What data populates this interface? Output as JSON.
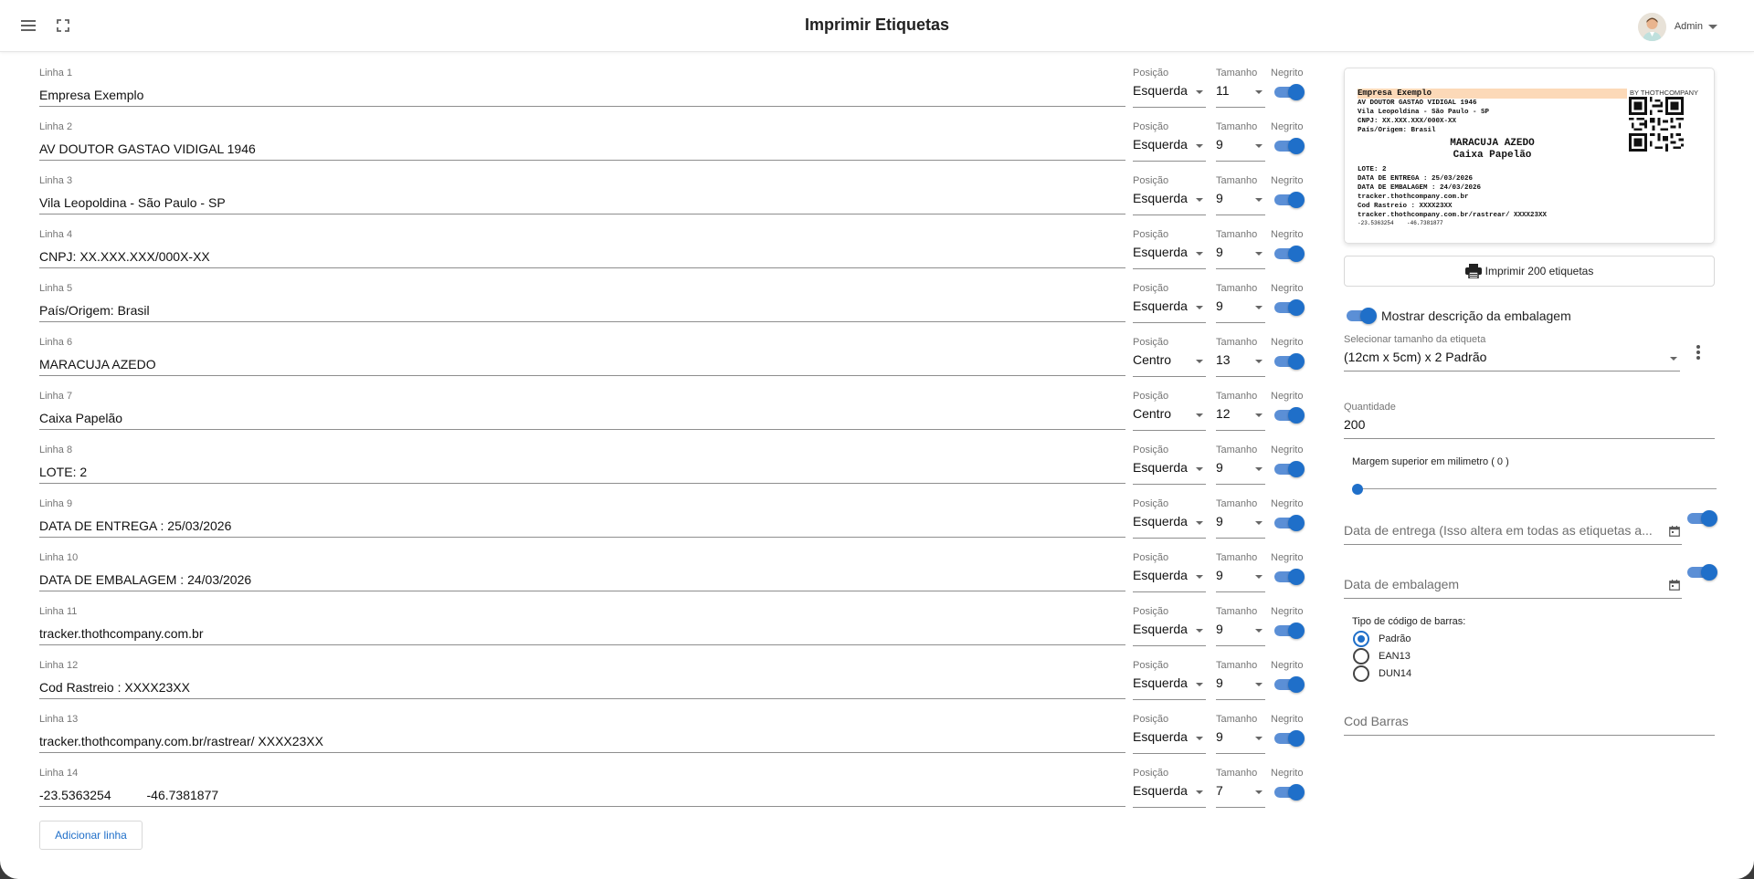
{
  "header": {
    "title": "Imprimir Etiquetas",
    "user": "Admin"
  },
  "columns": {
    "position_label": "Posição",
    "size_label": "Tamanho",
    "bold_label": "Negrito"
  },
  "lines": [
    {
      "label": "Linha 1",
      "value": "Empresa Exemplo",
      "position": "Esquerda",
      "size": "11",
      "bold": true
    },
    {
      "label": "Linha 2",
      "value": "AV DOUTOR GASTAO VIDIGAL 1946",
      "position": "Esquerda",
      "size": "9",
      "bold": true
    },
    {
      "label": "Linha 3",
      "value": "Vila Leopoldina - São Paulo - SP",
      "position": "Esquerda",
      "size": "9",
      "bold": true
    },
    {
      "label": "Linha 4",
      "value": "CNPJ: XX.XXX.XXX/000X-XX",
      "position": "Esquerda",
      "size": "9",
      "bold": true
    },
    {
      "label": "Linha 5",
      "value": "País/Origem: Brasil",
      "position": "Esquerda",
      "size": "9",
      "bold": true
    },
    {
      "label": "Linha 6",
      "value": "MARACUJA AZEDO",
      "position": "Centro",
      "size": "13",
      "bold": true
    },
    {
      "label": "Linha 7",
      "value": "Caixa Papelão",
      "position": "Centro",
      "size": "12",
      "bold": true
    },
    {
      "label": "Linha 8",
      "value": "LOTE: 2",
      "position": "Esquerda",
      "size": "9",
      "bold": true
    },
    {
      "label": "Linha 9",
      "value": "DATA DE ENTREGA : 25/03/2026",
      "position": "Esquerda",
      "size": "9",
      "bold": true
    },
    {
      "label": "Linha 10",
      "value": "DATA DE EMBALAGEM : 24/03/2026",
      "position": "Esquerda",
      "size": "9",
      "bold": true
    },
    {
      "label": "Linha 11",
      "value": "tracker.thothcompany.com.br",
      "position": "Esquerda",
      "size": "9",
      "bold": true
    },
    {
      "label": "Linha 12",
      "value": "Cod Rastreio : XXXX23XX",
      "position": "Esquerda",
      "size": "9",
      "bold": true
    },
    {
      "label": "Linha 13",
      "value": "tracker.thothcompany.com.br/rastrear/ XXXX23XX",
      "position": "Esquerda",
      "size": "9",
      "bold": true
    },
    {
      "label": "Linha 14",
      "value": "-23.5363254          -46.7381877",
      "position": "Esquerda",
      "size": "7",
      "bold": true
    }
  ],
  "add_line_label": "Adicionar linha",
  "preview": {
    "brand": "BY THOTHCOMPANY",
    "lines": [
      "Empresa Exemplo",
      "AV DOUTOR GASTAO VIDIGAL 1946",
      "Vila Leopoldina - São Paulo - SP",
      "CNPJ: XX.XXX.XXX/000X-XX",
      "País/Origem: Brasil",
      "MARACUJA AZEDO",
      "Caixa Papelão",
      "LOTE: 2",
      "DATA DE ENTREGA : 25/03/2026",
      "DATA DE EMBALAGEM : 24/03/2026",
      "tracker.thothcompany.com.br",
      "Cod Rastreio : XXXX23XX",
      "tracker.thothcompany.com.br/rastrear/ XXXX23XX",
      "-23.5363254    -46.7381877"
    ]
  },
  "print_button": "Imprimir 200 etiquetas",
  "show_description": {
    "label": "Mostrar descrição da embalagem",
    "on": true
  },
  "label_size": {
    "label": "Selecionar tamanho da etiqueta",
    "value": "(12cm x 5cm) x 2 Padrão"
  },
  "quantity": {
    "label": "Quantidade",
    "value": "200"
  },
  "top_margin": {
    "label": "Margem superior em milimetro ( 0 )",
    "value": 0
  },
  "delivery_date": {
    "placeholder": "Data de entrega (Isso altera em todas as etiquetas a..."
  },
  "packing_date": {
    "placeholder": "Data de embalagem"
  },
  "barcode_type": {
    "title": "Tipo de código de barras:",
    "options": [
      "Padrão",
      "EAN13",
      "DUN14"
    ],
    "selected": "Padrão"
  },
  "barcode": {
    "placeholder": "Cod Barras"
  },
  "colors": {
    "accent": "#1f6fc9",
    "highlight": "#fcd9b8"
  }
}
